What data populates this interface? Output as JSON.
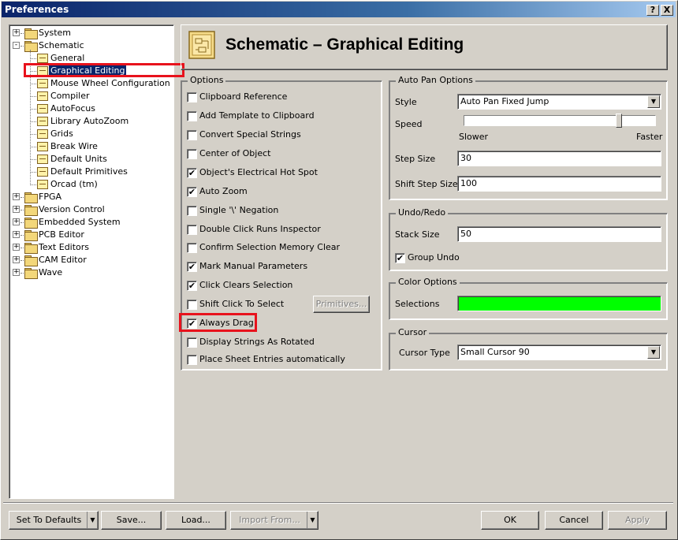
{
  "window": {
    "title": "Preferences",
    "help_btn": "?",
    "close_btn": "X"
  },
  "tree": {
    "top": [
      {
        "label": "System",
        "expander": "+"
      },
      {
        "label": "Schematic",
        "expander": "-"
      }
    ],
    "schematic_children": [
      "General",
      "Graphical Editing",
      "Mouse Wheel Configuration",
      "Compiler",
      "AutoFocus",
      "Library AutoZoom",
      "Grids",
      "Break Wire",
      "Default Units",
      "Default Primitives",
      "Orcad (tm)"
    ],
    "bottom": [
      {
        "label": "FPGA",
        "expander": "+"
      },
      {
        "label": "Version Control",
        "expander": "+"
      },
      {
        "label": "Embedded System",
        "expander": "+"
      },
      {
        "label": "PCB Editor",
        "expander": "+"
      },
      {
        "label": "Text Editors",
        "expander": "+"
      },
      {
        "label": "CAM Editor",
        "expander": "+"
      },
      {
        "label": "Wave",
        "expander": "+"
      }
    ],
    "selected": "Graphical Editing"
  },
  "header": {
    "title": "Schematic – Graphical Editing",
    "icon": "schematic-page-icon"
  },
  "options": {
    "title": "Options",
    "items": [
      {
        "label": "Clipboard Reference",
        "checked": false
      },
      {
        "label": "Add Template to Clipboard",
        "checked": false
      },
      {
        "label": "Convert Special Strings",
        "checked": false
      },
      {
        "label": "Center of Object",
        "checked": false
      },
      {
        "label": "Object's Electrical Hot Spot",
        "checked": true
      },
      {
        "label": "Auto Zoom",
        "checked": true
      },
      {
        "label": "Single '\\' Negation",
        "checked": false
      },
      {
        "label": "Double Click Runs Inspector",
        "checked": false
      },
      {
        "label": "Confirm Selection Memory Clear",
        "checked": false
      },
      {
        "label": "Mark Manual Parameters",
        "checked": true
      },
      {
        "label": "Click Clears Selection",
        "checked": true
      },
      {
        "label": "Shift Click To Select",
        "checked": false
      },
      {
        "label": "Always Drag",
        "checked": true
      },
      {
        "label": "Display Strings As Rotated",
        "checked": false
      },
      {
        "label": "Place Sheet Entries automatically",
        "checked": false
      }
    ],
    "primitives_btn": "Primitives...",
    "check_glyph": "✔"
  },
  "auto_pan": {
    "title": "Auto Pan Options",
    "style_label": "Style",
    "style_value": "Auto Pan Fixed Jump",
    "speed_label": "Speed",
    "speed_fraction": 0.82,
    "slower": "Slower",
    "faster": "Faster",
    "step_label": "Step Size",
    "step_value": "30",
    "shift_step_label": "Shift Step Size",
    "shift_step_value": "100"
  },
  "undo": {
    "title": "Undo/Redo",
    "stack_label": "Stack Size",
    "stack_value": "50",
    "group_undo_label": "Group Undo",
    "group_undo_checked": true
  },
  "color": {
    "title": "Color Options",
    "selections_label": "Selections",
    "selections_color": "#00ff00"
  },
  "cursor": {
    "title": "Cursor",
    "type_label": "Cursor Type",
    "type_value": "Small Cursor 90"
  },
  "footer": {
    "set_defaults": "Set To Defaults",
    "save": "Save...",
    "load": "Load...",
    "import_from": "Import From...",
    "ok": "OK",
    "cancel": "Cancel",
    "apply": "Apply"
  },
  "combo_arrow": "▼",
  "highlight_color": "#e8121c"
}
